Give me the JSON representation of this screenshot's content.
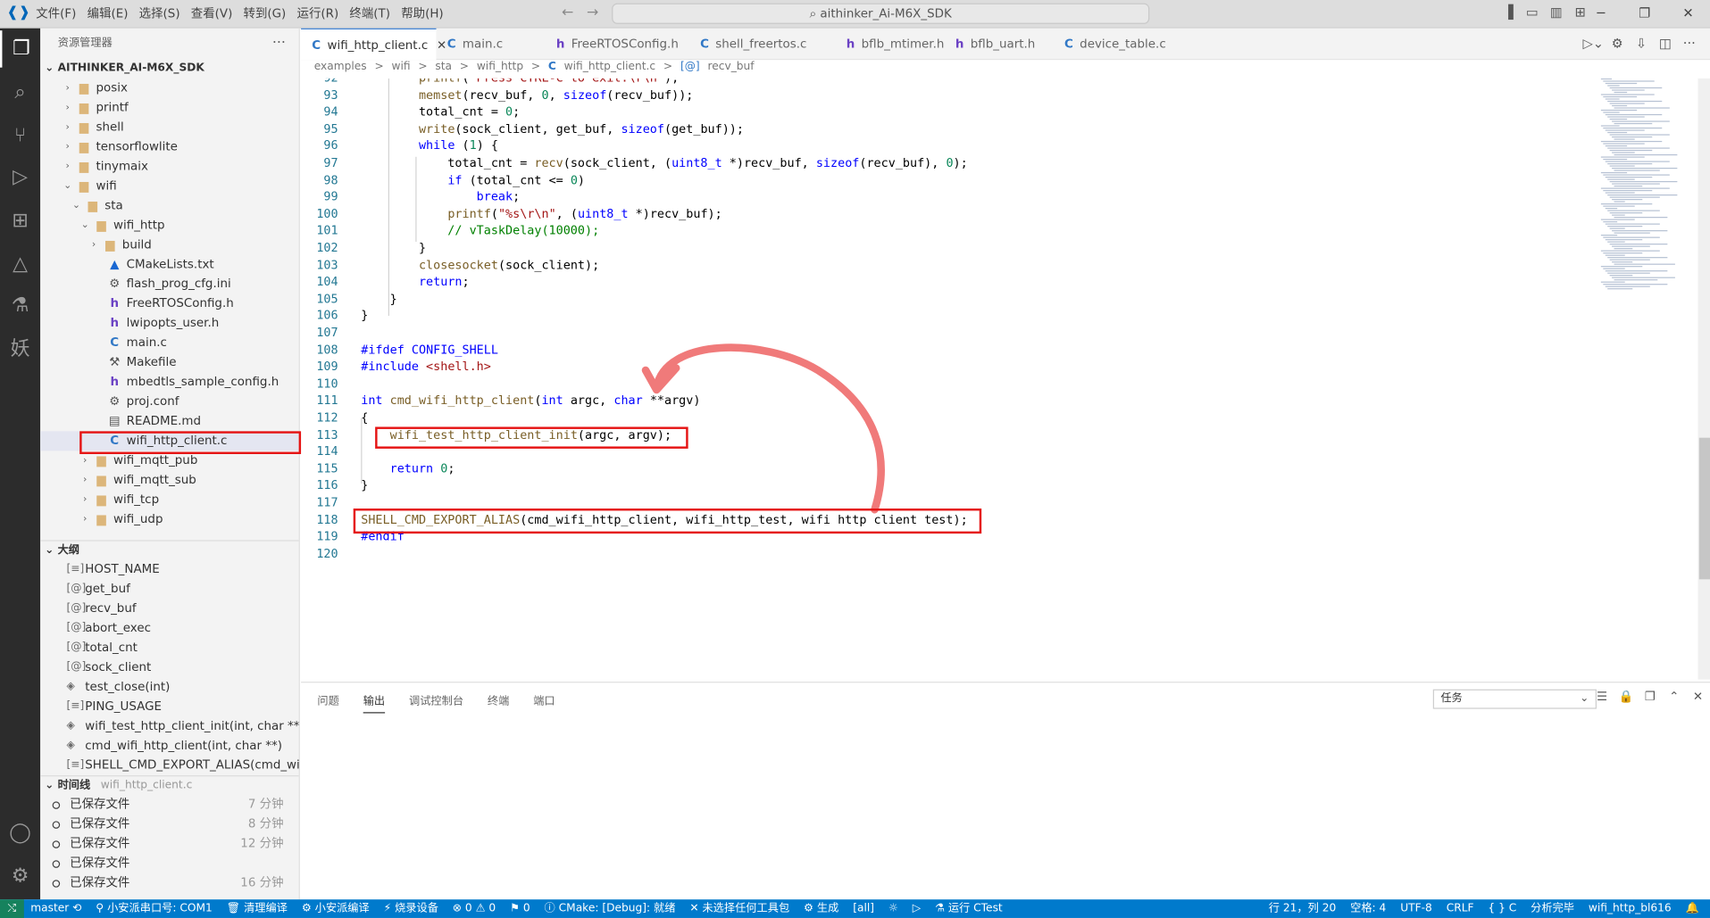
{
  "titlebar": {
    "menu": [
      "文件(F)",
      "编辑(E)",
      "选择(S)",
      "查看(V)",
      "转到(G)",
      "运行(R)",
      "终端(T)",
      "帮助(H)"
    ],
    "search": "aithinker_Ai-M6X_SDK"
  },
  "sidebar": {
    "header": "资源管理器",
    "more": "···",
    "root": "AITHINKER_AI-M6X_SDK",
    "tree": [
      {
        "label": "posix",
        "depth": 1,
        "kind": "folder",
        "expanded": false
      },
      {
        "label": "printf",
        "depth": 1,
        "kind": "folder",
        "expanded": false
      },
      {
        "label": "shell",
        "depth": 1,
        "kind": "folder",
        "expanded": false
      },
      {
        "label": "tensorflowlite",
        "depth": 1,
        "kind": "folder",
        "expanded": false
      },
      {
        "label": "tinymaix",
        "depth": 1,
        "kind": "folder",
        "expanded": false
      },
      {
        "label": "wifi",
        "depth": 1,
        "kind": "folder",
        "expanded": true
      },
      {
        "label": "sta",
        "depth": 2,
        "kind": "folder",
        "expanded": true
      },
      {
        "label": "wifi_http",
        "depth": 3,
        "kind": "folder",
        "expanded": true
      },
      {
        "label": "build",
        "depth": 4,
        "kind": "folder",
        "expanded": false
      },
      {
        "label": "CMakeLists.txt",
        "depth": 4,
        "kind": "cmake"
      },
      {
        "label": "flash_prog_cfg.ini",
        "depth": 4,
        "kind": "gear"
      },
      {
        "label": "FreeRTOSConfig.h",
        "depth": 4,
        "kind": "h"
      },
      {
        "label": "lwipopts_user.h",
        "depth": 4,
        "kind": "h"
      },
      {
        "label": "main.c",
        "depth": 4,
        "kind": "c"
      },
      {
        "label": "Makefile",
        "depth": 4,
        "kind": "make"
      },
      {
        "label": "mbedtls_sample_config.h",
        "depth": 4,
        "kind": "h"
      },
      {
        "label": "proj.conf",
        "depth": 4,
        "kind": "gear"
      },
      {
        "label": "README.md",
        "depth": 4,
        "kind": "md"
      },
      {
        "label": "wifi_http_client.c",
        "depth": 4,
        "kind": "c",
        "selected": true
      },
      {
        "label": "wifi_mqtt_pub",
        "depth": 3,
        "kind": "folder",
        "expanded": false
      },
      {
        "label": "wifi_mqtt_sub",
        "depth": 3,
        "kind": "folder",
        "expanded": false
      },
      {
        "label": "wifi_tcp",
        "depth": 3,
        "kind": "folder",
        "expanded": false
      },
      {
        "label": "wifi_udp",
        "depth": 3,
        "kind": "folder",
        "expanded": false
      }
    ],
    "outline_header": "大纲",
    "outline": [
      {
        "icon": "[≡]",
        "label": "HOST_NAME"
      },
      {
        "icon": "[@]",
        "label": "get_buf"
      },
      {
        "icon": "[@]",
        "label": "recv_buf"
      },
      {
        "icon": "[@]",
        "label": "abort_exec"
      },
      {
        "icon": "[@]",
        "label": "total_cnt"
      },
      {
        "icon": "[@]",
        "label": "sock_client"
      },
      {
        "icon": "◈",
        "label": "test_close(int)"
      },
      {
        "icon": "[≡]",
        "label": "PING_USAGE"
      },
      {
        "icon": "◈",
        "label": "wifi_test_http_client_init(int, char **)"
      },
      {
        "icon": "◈",
        "label": "cmd_wifi_http_client(int, char **)"
      },
      {
        "icon": "[≡]",
        "label": "SHELL_CMD_EXPORT_ALIAS(cmd_wifi_ht..."
      }
    ],
    "timeline_header": "时间线",
    "timeline_file": "wifi_http_client.c",
    "timeline": [
      {
        "label": "已保存文件",
        "time": "7 分钟"
      },
      {
        "label": "已保存文件",
        "time": "8 分钟"
      },
      {
        "label": "已保存文件",
        "time": "12 分钟"
      },
      {
        "label": "已保存文件",
        "time": ""
      },
      {
        "label": "已保存文件",
        "time": "16 分钟"
      }
    ]
  },
  "tabs": [
    {
      "icon": "C",
      "label": "wifi_http_client.c",
      "active": true,
      "close": "✕"
    },
    {
      "icon": "C",
      "label": "main.c"
    },
    {
      "icon": "h",
      "label": "FreeRTOSConfig.h"
    },
    {
      "icon": "C",
      "label": "shell_freertos.c"
    },
    {
      "icon": "h",
      "label": "bflb_mtimer.h"
    },
    {
      "icon": "h",
      "label": "bflb_uart.h"
    },
    {
      "icon": "C",
      "label": "device_table.c"
    }
  ],
  "breadcrumb": [
    "examples",
    ">",
    "wifi",
    ">",
    "sta",
    ">",
    "wifi_http",
    ">",
    "C",
    "wifi_http_client.c",
    ">",
    "[@]",
    "recv_buf"
  ],
  "editor": {
    "lines": [
      {
        "n": "92",
        "code": "        printf(\"Press CTRL-C to exit.\\r\\n\");"
      },
      {
        "n": "93",
        "code": "        memset(recv_buf, 0, sizeof(recv_buf));"
      },
      {
        "n": "94",
        "code": "        total_cnt = 0;"
      },
      {
        "n": "95",
        "code": "        write(sock_client, get_buf, sizeof(get_buf));"
      },
      {
        "n": "96",
        "code": "        while (1) {"
      },
      {
        "n": "97",
        "code": "            total_cnt = recv(sock_client, (uint8_t *)recv_buf, sizeof(recv_buf), 0);"
      },
      {
        "n": "98",
        "code": "            if (total_cnt <= 0)"
      },
      {
        "n": "99",
        "code": "                break;"
      },
      {
        "n": "100",
        "code": "            printf(\"%s\\r\\n\", (uint8_t *)recv_buf);"
      },
      {
        "n": "101",
        "code": "            // vTaskDelay(10000);"
      },
      {
        "n": "102",
        "code": "        }"
      },
      {
        "n": "103",
        "code": "        closesocket(sock_client);"
      },
      {
        "n": "104",
        "code": "        return;"
      },
      {
        "n": "105",
        "code": "    }"
      },
      {
        "n": "106",
        "code": "}"
      },
      {
        "n": "107",
        "code": ""
      },
      {
        "n": "108",
        "code": "#ifdef CONFIG_SHELL"
      },
      {
        "n": "109",
        "code": "#include <shell.h>"
      },
      {
        "n": "110",
        "code": ""
      },
      {
        "n": "111",
        "code": "int cmd_wifi_http_client(int argc, char **argv)"
      },
      {
        "n": "112",
        "code": "{"
      },
      {
        "n": "113",
        "code": "    wifi_test_http_client_init(argc, argv);"
      },
      {
        "n": "114",
        "code": ""
      },
      {
        "n": "115",
        "code": "    return 0;"
      },
      {
        "n": "116",
        "code": "}"
      },
      {
        "n": "117",
        "code": ""
      },
      {
        "n": "118",
        "code": "SHELL_CMD_EXPORT_ALIAS(cmd_wifi_http_client, wifi_http_test, wifi http client test);"
      },
      {
        "n": "119",
        "code": "#endif"
      },
      {
        "n": "120",
        "code": ""
      }
    ]
  },
  "panel": {
    "tabs": [
      "问题",
      "输出",
      "调试控制台",
      "终端",
      "端口"
    ],
    "active": "输出",
    "select": "任务"
  },
  "statusbar": {
    "left": [
      "master ⟲",
      "⚲ 小安派串口号: COM1",
      "🗑 清理编译",
      "⚙ 小安派编译",
      "⚡ 烧录设备",
      "⊗ 0 ⚠ 0",
      "⚑ 0",
      "ⓘ CMake: [Debug]: 就绪",
      "✕ 未选择任何工具包",
      "⚙ 生成",
      "[all]",
      "☼",
      "▷",
      "⚗ 运行 CTest"
    ],
    "right": [
      "行 21，列 20",
      "空格: 4",
      "UTF-8",
      "CRLF",
      "{ } C",
      "分析完毕",
      "wifi_http_bl616",
      "🔔"
    ]
  },
  "colors": {
    "accent": "#007acc",
    "highlight": "#e51414",
    "arrow": "#f07a7a"
  }
}
